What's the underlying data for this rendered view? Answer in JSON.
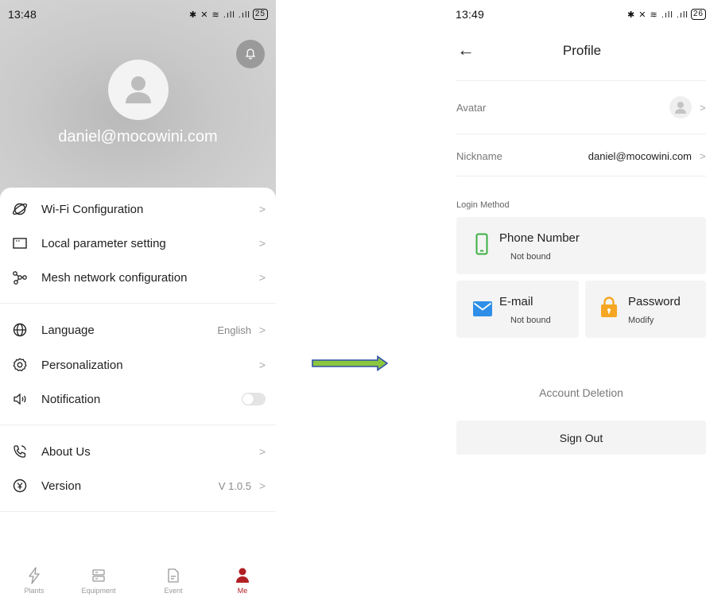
{
  "left_screen": {
    "status_bar": {
      "time": "13:48",
      "indicators": "✱ ✕ ≋ .ıll .ıll",
      "battery": "25"
    },
    "profile": {
      "email": "daniel@mocowini.com"
    },
    "menu": [
      {
        "label": "Wi-Fi Configuration",
        "icon": "planet-icon"
      },
      {
        "label": "Local parameter setting",
        "icon": "window-icon"
      },
      {
        "label": "Mesh network configuration",
        "icon": "mesh-icon"
      },
      {
        "label": "Language",
        "value": "English",
        "icon": "globe-icon"
      },
      {
        "label": "Personalization",
        "icon": "gear-icon"
      },
      {
        "label": "Notification",
        "icon": "speaker-icon",
        "toggle": false
      },
      {
        "label": "About Us",
        "icon": "phone-icon"
      },
      {
        "label": "Version",
        "value": "V 1.0.5",
        "icon": "yen-circle-icon"
      }
    ],
    "tabs": [
      {
        "label": "Plants",
        "icon": "lightning-icon"
      },
      {
        "label": "Equipment",
        "icon": "server-icon"
      },
      {
        "label": "Event",
        "icon": "document-icon"
      },
      {
        "label": "Me",
        "icon": "person-icon",
        "active": true
      }
    ]
  },
  "right_screen": {
    "status_bar": {
      "time": "13:49",
      "indicators": "✱ ✕ ≋ .ıll .ıll",
      "battery": "26"
    },
    "title": "Profile",
    "avatar_label": "Avatar",
    "nickname_label": "Nickname",
    "nickname_value": "daniel@mocowini.com",
    "login_method_label": "Login Method",
    "phone": {
      "title": "Phone Number",
      "status": "Not bound"
    },
    "email": {
      "title": "E-mail",
      "status": "Not bound"
    },
    "password": {
      "title": "Password",
      "status": "Modify"
    },
    "account_deletion": "Account Deletion",
    "sign_out": "Sign Out"
  },
  "colors": {
    "accent_red": "#b01f24",
    "phone_green": "#3cb043",
    "mail_blue": "#2f8fe8",
    "lock_orange": "#f5a623",
    "arrow_green": "#8cc63f",
    "arrow_blue": "#2e4ea8"
  }
}
